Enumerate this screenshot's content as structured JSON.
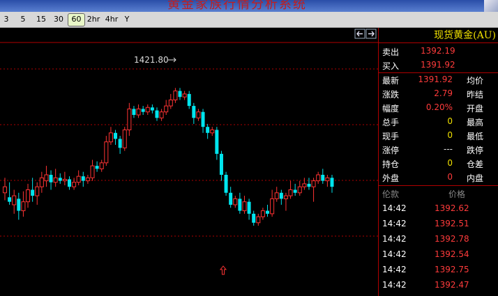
{
  "app": {
    "title": "黄金家族行情分析系统"
  },
  "periods": [
    "3",
    "5",
    "15",
    "30",
    "60",
    "2hr",
    "4hr",
    "Y"
  ],
  "active_period": "60",
  "colors": {
    "up": "#ff3333",
    "down": "#00e5ee",
    "accent": "#f0e000",
    "grid": "#b00000"
  },
  "icons": [
    "arrow-left-icon",
    "arrow-right-icon",
    "up-arrow-marker-icon"
  ],
  "quote": {
    "name": "现货黄金(AU)",
    "sell_label": "卖出",
    "sell": "1392.19",
    "buy_label": "买入",
    "buy": "1391.92",
    "rows": [
      {
        "l": "最新",
        "v": "1391.92",
        "r": "均价",
        "c": "red"
      },
      {
        "l": "涨跌",
        "v": "2.79",
        "r": "昨结",
        "c": "red"
      },
      {
        "l": "幅度",
        "v": "0.20%",
        "r": "开盘",
        "c": "red"
      },
      {
        "l": "总手",
        "v": "0",
        "r": "最高",
        "c": "yellow"
      },
      {
        "l": "现手",
        "v": "0",
        "r": "最低",
        "c": "yellow"
      },
      {
        "l": "涨停",
        "v": "---",
        "r": "跌停",
        "c": "white"
      },
      {
        "l": "持仓",
        "v": "0",
        "r": "仓差",
        "c": "yellow"
      },
      {
        "l": "外盘",
        "v": "0",
        "r": "内盘",
        "c": "red"
      }
    ]
  },
  "ticks": {
    "header_time": "伦款",
    "header_price": "价格",
    "rows": [
      {
        "time": "14:42",
        "price": "1392.62"
      },
      {
        "time": "14:42",
        "price": "1392.51"
      },
      {
        "time": "14:42",
        "price": "1392.78"
      },
      {
        "time": "14:42",
        "price": "1392.54"
      },
      {
        "time": "14:42",
        "price": "1392.75"
      },
      {
        "time": "14:42",
        "price": "1392.47"
      }
    ]
  },
  "chart_data": {
    "type": "candlestick",
    "max_label": "1421.80",
    "candles": [
      [
        0,
        0.48,
        0.52,
        0.43,
        0.58
      ],
      [
        1,
        0.45,
        0.42,
        0.4,
        0.55
      ],
      [
        0,
        0.4,
        0.46,
        0.34,
        0.5
      ],
      [
        1,
        0.44,
        0.36,
        0.3,
        0.48
      ],
      [
        0,
        0.36,
        0.42,
        0.32,
        0.49
      ],
      [
        0,
        0.42,
        0.5,
        0.38,
        0.54
      ],
      [
        1,
        0.5,
        0.46,
        0.42,
        0.58
      ],
      [
        0,
        0.46,
        0.52,
        0.4,
        0.55
      ],
      [
        0,
        0.52,
        0.58,
        0.48,
        0.62
      ],
      [
        0,
        0.56,
        0.6,
        0.52,
        0.66
      ],
      [
        1,
        0.6,
        0.55,
        0.5,
        0.63
      ],
      [
        0,
        0.55,
        0.58,
        0.52,
        0.64
      ],
      [
        1,
        0.58,
        0.56,
        0.54,
        0.61
      ],
      [
        0,
        0.56,
        0.57,
        0.53,
        0.62
      ],
      [
        1,
        0.57,
        0.52,
        0.5,
        0.59
      ],
      [
        0,
        0.52,
        0.55,
        0.5,
        0.58
      ],
      [
        0,
        0.55,
        0.59,
        0.53,
        0.63
      ],
      [
        1,
        0.59,
        0.56,
        0.52,
        0.62
      ],
      [
        0,
        0.56,
        0.58,
        0.54,
        0.6
      ],
      [
        0,
        0.58,
        0.66,
        0.56,
        0.7
      ],
      [
        1,
        0.66,
        0.64,
        0.62,
        0.69
      ],
      [
        0,
        0.64,
        0.68,
        0.62,
        0.7
      ],
      [
        0,
        0.68,
        0.82,
        0.66,
        0.86
      ],
      [
        0,
        0.82,
        0.88,
        0.8,
        0.92
      ],
      [
        1,
        0.88,
        0.84,
        0.8,
        0.9
      ],
      [
        1,
        0.84,
        0.78,
        0.74,
        0.86
      ],
      [
        0,
        0.78,
        0.9,
        0.76,
        0.92
      ],
      [
        0,
        0.9,
        1.04,
        0.86,
        1.08
      ],
      [
        1,
        1.04,
        1.0,
        0.98,
        1.06
      ],
      [
        0,
        1.0,
        1.04,
        0.98,
        1.07
      ],
      [
        1,
        1.04,
        1.02,
        1.0,
        1.06
      ],
      [
        0,
        1.02,
        1.05,
        1.0,
        1.07
      ],
      [
        1,
        1.05,
        1.03,
        1.01,
        1.07
      ],
      [
        1,
        1.03,
        0.98,
        0.96,
        1.05
      ],
      [
        0,
        0.98,
        1.02,
        0.96,
        1.04
      ],
      [
        0,
        1.02,
        1.06,
        1.0,
        1.1
      ],
      [
        0,
        1.06,
        1.1,
        1.04,
        1.14
      ],
      [
        0,
        1.1,
        1.16,
        1.08,
        1.18
      ],
      [
        1,
        1.16,
        1.12,
        1.1,
        1.18
      ],
      [
        0,
        1.12,
        1.14,
        1.1,
        1.16
      ],
      [
        1,
        1.14,
        1.06,
        1.04,
        1.16
      ],
      [
        1,
        1.06,
        0.98,
        0.94,
        1.08
      ],
      [
        0,
        0.98,
        1.02,
        0.96,
        1.04
      ],
      [
        1,
        1.02,
        0.92,
        0.88,
        1.04
      ],
      [
        1,
        0.92,
        0.88,
        0.84,
        0.94
      ],
      [
        0,
        0.88,
        0.9,
        0.86,
        0.92
      ],
      [
        1,
        0.9,
        0.74,
        0.7,
        0.92
      ],
      [
        1,
        0.74,
        0.6,
        0.56,
        0.76
      ],
      [
        1,
        0.6,
        0.48,
        0.46,
        0.62
      ],
      [
        1,
        0.48,
        0.4,
        0.38,
        0.52
      ],
      [
        0,
        0.4,
        0.44,
        0.38,
        0.46
      ],
      [
        1,
        0.44,
        0.36,
        0.34,
        0.48
      ],
      [
        0,
        0.36,
        0.42,
        0.34,
        0.46
      ],
      [
        1,
        0.42,
        0.34,
        0.3,
        0.44
      ],
      [
        1,
        0.34,
        0.28,
        0.26,
        0.36
      ],
      [
        0,
        0.28,
        0.32,
        0.26,
        0.34
      ],
      [
        0,
        0.32,
        0.36,
        0.3,
        0.38
      ],
      [
        1,
        0.36,
        0.34,
        0.32,
        0.4
      ],
      [
        0,
        0.34,
        0.44,
        0.32,
        0.5
      ],
      [
        0,
        0.44,
        0.48,
        0.42,
        0.52
      ],
      [
        1,
        0.48,
        0.44,
        0.4,
        0.5
      ],
      [
        0,
        0.44,
        0.46,
        0.36,
        0.48
      ],
      [
        0,
        0.46,
        0.5,
        0.44,
        0.56
      ],
      [
        1,
        0.5,
        0.48,
        0.46,
        0.54
      ],
      [
        0,
        0.48,
        0.52,
        0.46,
        0.56
      ],
      [
        0,
        0.52,
        0.54,
        0.5,
        0.58
      ],
      [
        1,
        0.54,
        0.52,
        0.5,
        0.58
      ],
      [
        0,
        0.52,
        0.56,
        0.42,
        0.58
      ],
      [
        0,
        0.56,
        0.6,
        0.54,
        0.62
      ],
      [
        1,
        0.6,
        0.56,
        0.54,
        0.64
      ],
      [
        0,
        0.56,
        0.58,
        0.52,
        0.6
      ],
      [
        1,
        0.58,
        0.52,
        0.48,
        0.6
      ]
    ]
  }
}
